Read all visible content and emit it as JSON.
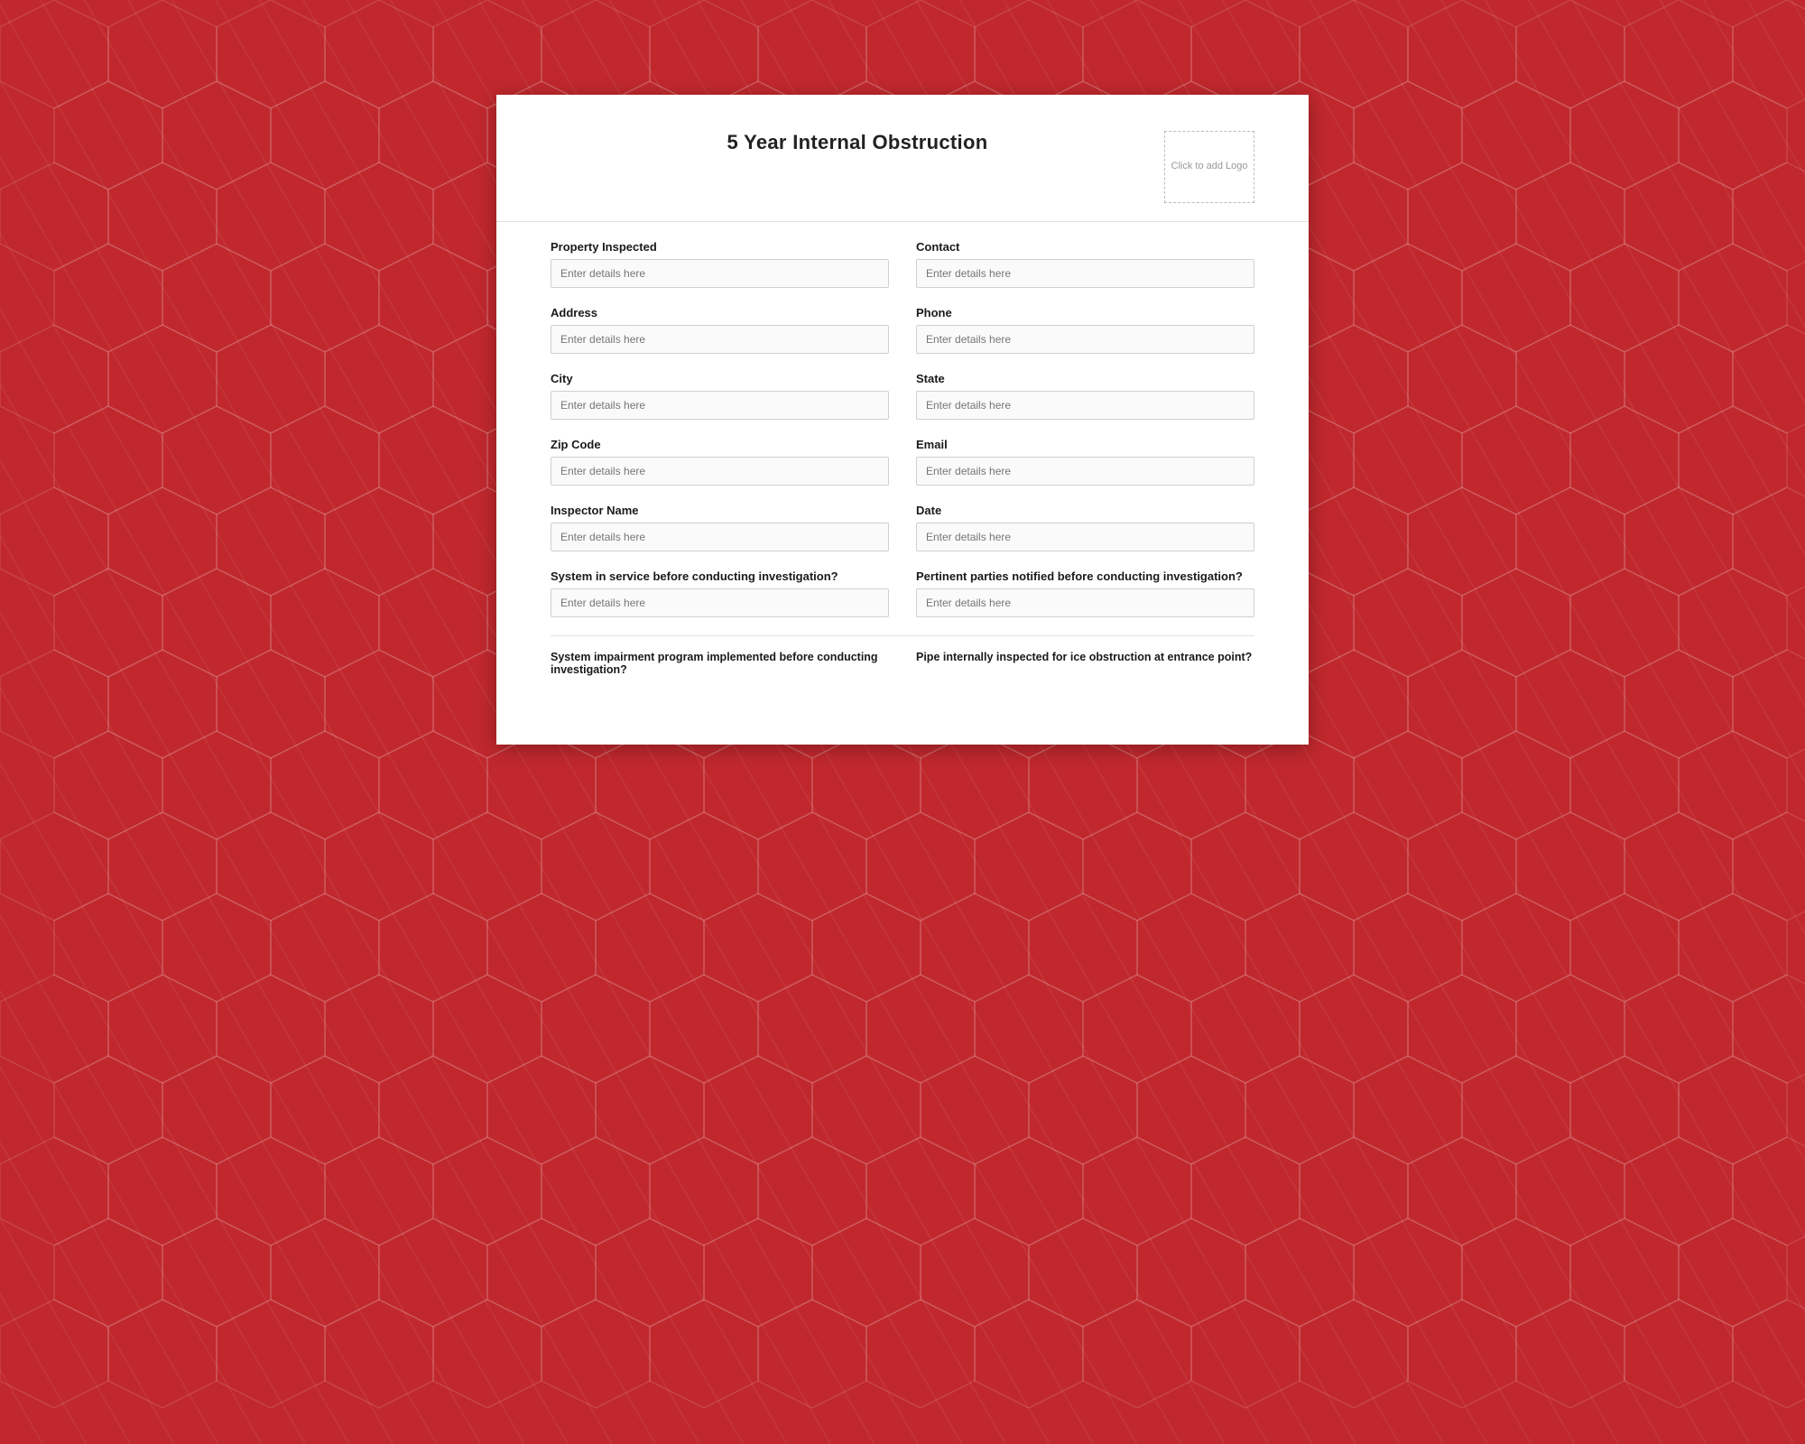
{
  "page": {
    "title": "5 Year Internal Obstruction",
    "logo_placeholder": "Click to add Logo"
  },
  "form": {
    "fields": [
      {
        "row": 1,
        "left": {
          "label": "Property Inspected",
          "placeholder": "Enter details here",
          "name": "property-inspected"
        },
        "right": {
          "label": "Contact",
          "placeholder": "Enter details here",
          "name": "contact"
        }
      },
      {
        "row": 2,
        "left": {
          "label": "Address",
          "placeholder": "Enter details here",
          "name": "address"
        },
        "right": {
          "label": "Phone",
          "placeholder": "Enter details here",
          "name": "phone"
        }
      },
      {
        "row": 3,
        "left": {
          "label": "City",
          "placeholder": "Enter details here",
          "name": "city"
        },
        "right": {
          "label": "State",
          "placeholder": "Enter details here",
          "name": "state"
        }
      },
      {
        "row": 4,
        "left": {
          "label": "Zip Code",
          "placeholder": "Enter details here",
          "name": "zip-code"
        },
        "right": {
          "label": "Email",
          "placeholder": "Enter details here",
          "name": "email"
        }
      },
      {
        "row": 5,
        "left": {
          "label": "Inspector Name",
          "placeholder": "Enter details here",
          "name": "inspector-name"
        },
        "right": {
          "label": "Date",
          "placeholder": "Enter details here",
          "name": "date"
        }
      },
      {
        "row": 6,
        "left": {
          "label": "System in service before conducting investigation?",
          "placeholder": "Enter details here",
          "name": "system-in-service"
        },
        "right": {
          "label": "Pertinent parties notified before conducting investigation?",
          "placeholder": "Enter details here",
          "name": "pertinent-parties-notified"
        }
      }
    ],
    "question_row": {
      "left_label": "System impairment program implemented before conducting investigation?",
      "right_label": "Pipe internally inspected for ice obstruction at entrance point?"
    }
  }
}
